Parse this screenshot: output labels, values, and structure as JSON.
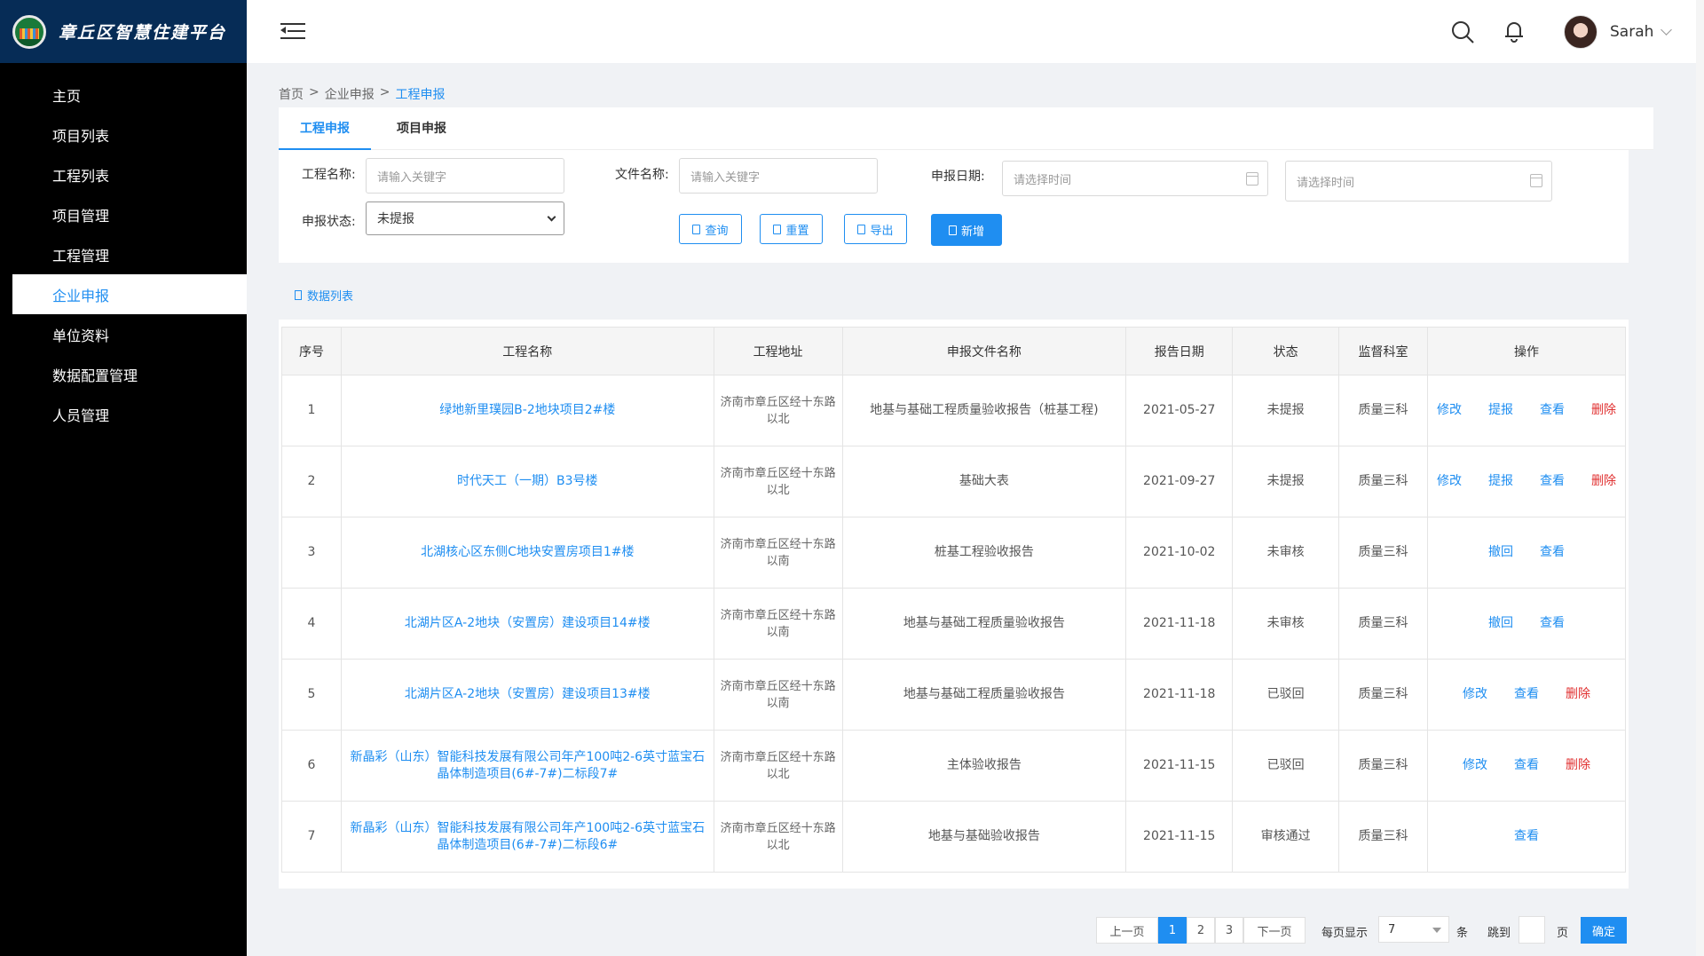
{
  "brand": {
    "title": "章丘区智慧住建平台"
  },
  "sidebar": {
    "items": [
      {
        "label": "主页"
      },
      {
        "label": "项目列表"
      },
      {
        "label": "工程列表"
      },
      {
        "label": "项目管理"
      },
      {
        "label": "工程管理"
      },
      {
        "label": "企业申报",
        "active": true
      },
      {
        "label": "单位资料"
      },
      {
        "label": "数据配置管理"
      },
      {
        "label": "人员管理"
      }
    ]
  },
  "header": {
    "user_name": "Sarah"
  },
  "breadcrumb": {
    "home": "首页",
    "sep": ">",
    "parent": "企业申报",
    "current": "工程申报"
  },
  "tabs": [
    {
      "label": "工程申报",
      "active": true
    },
    {
      "label": "项目申报"
    }
  ],
  "filters": {
    "project_name_label": "工程名称:",
    "project_name_placeholder": "请输入关键字",
    "file_name_label": "文件名称:",
    "file_name_placeholder": "请输入关键字",
    "date_label": "申报日期:",
    "date_start_placeholder": "请选择时间",
    "date_end_placeholder": "请选择时间",
    "status_label": "申报状态:",
    "status_value": "未提报"
  },
  "buttons": {
    "query": "查询",
    "reset": "重置",
    "export": "导出",
    "add": "新增"
  },
  "list_title": "数据列表",
  "table": {
    "headers": [
      "序号",
      "工程名称",
      "工程地址",
      "申报文件名称",
      "报告日期",
      "状态",
      "监督科室",
      "操作"
    ],
    "rows": [
      {
        "no": "1",
        "name": "绿地新里璞园B-2地块项目2#楼",
        "addr": "济南市章丘区经十东路以北",
        "file": "地基与基础工程质量验收报告（桩基工程)",
        "date": "2021-05-27",
        "status": "未提报",
        "dept": "质量三科",
        "ops": [
          "修改",
          "提报",
          "查看",
          "删除"
        ]
      },
      {
        "no": "2",
        "name": "时代天工（一期）B3号楼",
        "addr": "济南市章丘区经十东路以北",
        "file": "基础大表",
        "date": "2021-09-27",
        "status": "未提报",
        "dept": "质量三科",
        "ops": [
          "修改",
          "提报",
          "查看",
          "删除"
        ]
      },
      {
        "no": "3",
        "name": "北湖核心区东侧C地块安置房项目1#楼",
        "addr": "济南市章丘区经十东路以南",
        "file": "桩基工程验收报告",
        "date": "2021-10-02",
        "status": "未审核",
        "dept": "质量三科",
        "ops": [
          "撤回",
          "查看"
        ]
      },
      {
        "no": "4",
        "name": "北湖片区A-2地块（安置房）建设项目14#楼",
        "addr": "济南市章丘区经十东路以南",
        "file": "地基与基础工程质量验收报告",
        "date": "2021-11-18",
        "status": "未审核",
        "dept": "质量三科",
        "ops": [
          "撤回",
          "查看"
        ]
      },
      {
        "no": "5",
        "name": "北湖片区A-2地块（安置房）建设项目13#楼",
        "addr": "济南市章丘区经十东路以南",
        "file": "地基与基础工程质量验收报告",
        "date": "2021-11-18",
        "status": "已驳回",
        "dept": "质量三科",
        "ops": [
          "修改",
          "查看",
          "删除"
        ]
      },
      {
        "no": "6",
        "name": "新晶彩（山东）智能科技发展有限公司年产100吨2-6英寸蓝宝石晶体制造项目(6#-7#)二标段7#",
        "addr": "济南市章丘区经十东路以北",
        "file": "主体验收报告",
        "date": "2021-11-15",
        "status": "已驳回",
        "dept": "质量三科",
        "ops": [
          "修改",
          "查看",
          "删除"
        ]
      },
      {
        "no": "7",
        "name": "新晶彩（山东）智能科技发展有限公司年产100吨2-6英寸蓝宝石晶体制造项目(6#-7#)二标段6#",
        "addr": "济南市章丘区经十东路以北",
        "file": "地基与基础验收报告",
        "date": "2021-11-15",
        "status": "审核通过",
        "dept": "质量三科",
        "ops": [
          "查看"
        ]
      }
    ]
  },
  "pagination": {
    "prev": "上一页",
    "pages": [
      "1",
      "2",
      "3"
    ],
    "current": "1",
    "next": "下一页",
    "per_page_label": "每页显示",
    "per_page_value": "7",
    "per_page_unit": "条",
    "jump_label": "跳到",
    "page_unit": "页",
    "confirm": "确定"
  },
  "colors": {
    "accent": "#1f8ef1",
    "sidebar_bg": "#000000",
    "brand_bg": "#062c56",
    "danger": "#e03030"
  }
}
